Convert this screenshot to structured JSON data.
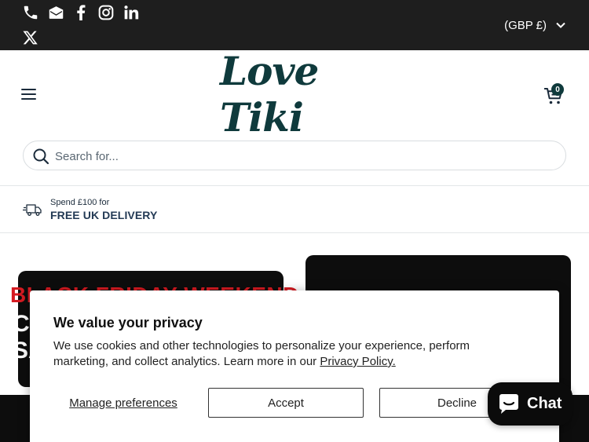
{
  "topbar": {
    "social_icons": [
      "phone-icon",
      "email-icon",
      "facebook-icon",
      "instagram-icon",
      "linkedin-icon",
      "x-icon"
    ],
    "currency_label": "(GBP £)"
  },
  "header": {
    "logo_text": "Love Tiki",
    "cart_count": "0"
  },
  "search": {
    "placeholder": "Search for..."
  },
  "delivery": {
    "small_text": "Spend £100 for",
    "big_text": "FREE UK DELIVERY"
  },
  "banner": {
    "headline": "BLACK FRIDAY WEEKEND",
    "line1": "C",
    "line2": "SA"
  },
  "cookie": {
    "title": "We value your privacy",
    "body": "We use cookies and other technologies to personalize your experience, perform marketing, and collect analytics. Learn more in our",
    "policy_link": "Privacy Policy.",
    "manage_label": "Manage preferences",
    "accept_label": "Accept",
    "decline_label": "Decline"
  },
  "chat": {
    "label": "Chat"
  },
  "colors": {
    "topbar_bg": "#1e1e1e",
    "brand_teal": "#0f3a3c",
    "sale_red": "#d51b22"
  }
}
